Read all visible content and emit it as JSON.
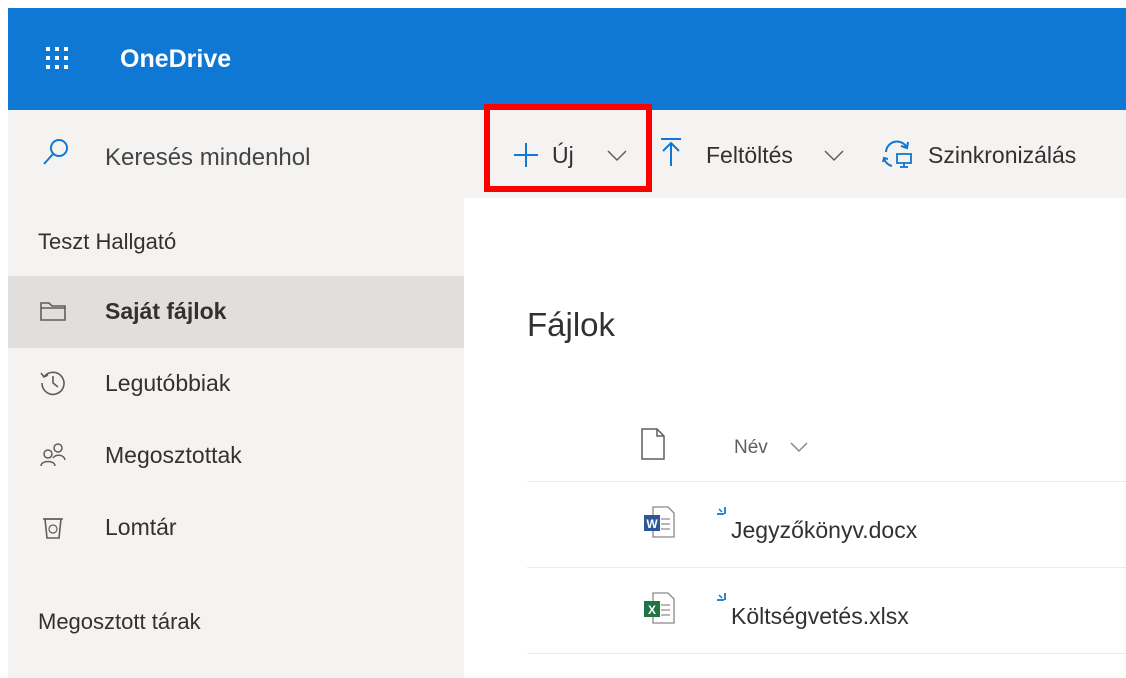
{
  "app": {
    "title": "OneDrive",
    "accent_color": "#0f78d4",
    "launcher_icon": "waffle-icon"
  },
  "sidebar": {
    "search_placeholder": "Keresés mindenhol",
    "user_name": "Teszt Hallgató",
    "items": [
      {
        "label": "Saját fájlok",
        "icon": "folder-icon",
        "active": true
      },
      {
        "label": "Legutóbbiak",
        "icon": "recent-icon",
        "active": false
      },
      {
        "label": "Megosztottak",
        "icon": "shared-people-icon",
        "active": false
      },
      {
        "label": "Lomtár",
        "icon": "recycle-bin-icon",
        "active": false
      }
    ],
    "section_title": "Megosztott tárak"
  },
  "toolbar": {
    "new_label": "Új",
    "upload_label": "Feltöltés",
    "sync_label": "Szinkronizálás",
    "highlight_color": "#ff0000"
  },
  "main": {
    "title": "Fájlok",
    "column_name": "Név",
    "files": [
      {
        "name": "Jegyzőkönyv.docx",
        "type": "word",
        "icon": "word-file-icon"
      },
      {
        "name": "Költségvetés.xlsx",
        "type": "excel",
        "icon": "excel-file-icon"
      }
    ]
  }
}
